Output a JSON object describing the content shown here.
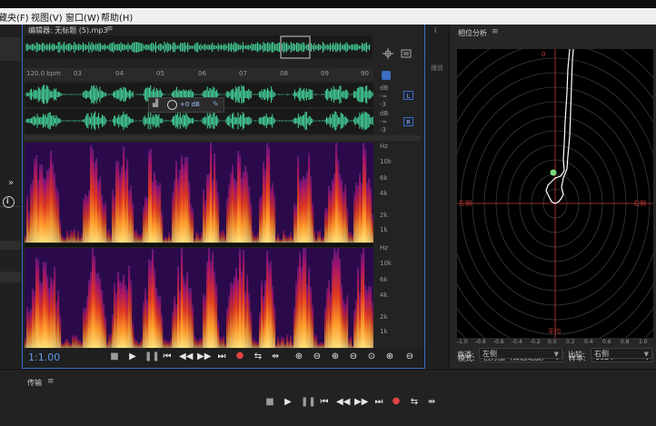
{
  "menubar": {
    "items": [
      {
        "label": "藏央(F)"
      },
      {
        "label": "视图(V)"
      },
      {
        "label": "窗口(W)"
      },
      {
        "label": "帮助(H)"
      }
    ]
  },
  "editor": {
    "title": "编辑器: 无标题 (5).mp3",
    "menu_glyph": "≡",
    "ruler": {
      "bpm": "120.0 bpm",
      "marks": [
        "03",
        "04",
        "05",
        "06",
        "07",
        "08",
        "09",
        "90"
      ]
    },
    "hud_level": "+0 dB",
    "channels": [
      {
        "label": "L",
        "db_top": "dB",
        "db_mid": "-∞",
        "db_bot": "-3"
      },
      {
        "label": "R",
        "db_top": "dB",
        "db_mid": "-∞",
        "db_bot": "-3"
      }
    ],
    "spec_scale": [
      "Hz",
      "10k",
      "6k",
      "4k",
      "2k",
      "1k"
    ],
    "zoom_display": "1:1.00"
  },
  "left_panel": {
    "expand_glyph": "»",
    "info_glyph": "i"
  },
  "mid_strip": {
    "info_glyph": "i",
    "item_label": "播放"
  },
  "phase": {
    "title": "相位分析",
    "menu_glyph": "≡",
    "axis_labels": {
      "top": "0",
      "left": "左侧",
      "right": "右侧",
      "bottom": "平均"
    },
    "x_ticks": [
      "-1.0",
      "-0.8",
      "-0.6",
      "-0.4",
      "-0.2",
      "0.0",
      "0.2",
      "0.4",
      "0.6",
      "0.8",
      "1.0"
    ],
    "mode_label": "模式:",
    "mode_value": "直方图（日志缩放）",
    "sample_label": "样本:",
    "sample_value": "1024",
    "channel_label": "声道:",
    "channel_value": "左侧",
    "compare_label": "比较:",
    "compare_value": "右侧",
    "colors": {
      "grid": "#3a3a3a",
      "axis_red": "#c23b3b",
      "trace": "#ffffff",
      "marker": "#7bd97b"
    }
  },
  "transport_panel": {
    "title": "传输",
    "menu_glyph": "≡"
  },
  "colors": {
    "waveform": "#44d39a",
    "accent_blue": "#3a6fc4",
    "record": "#e04343"
  }
}
